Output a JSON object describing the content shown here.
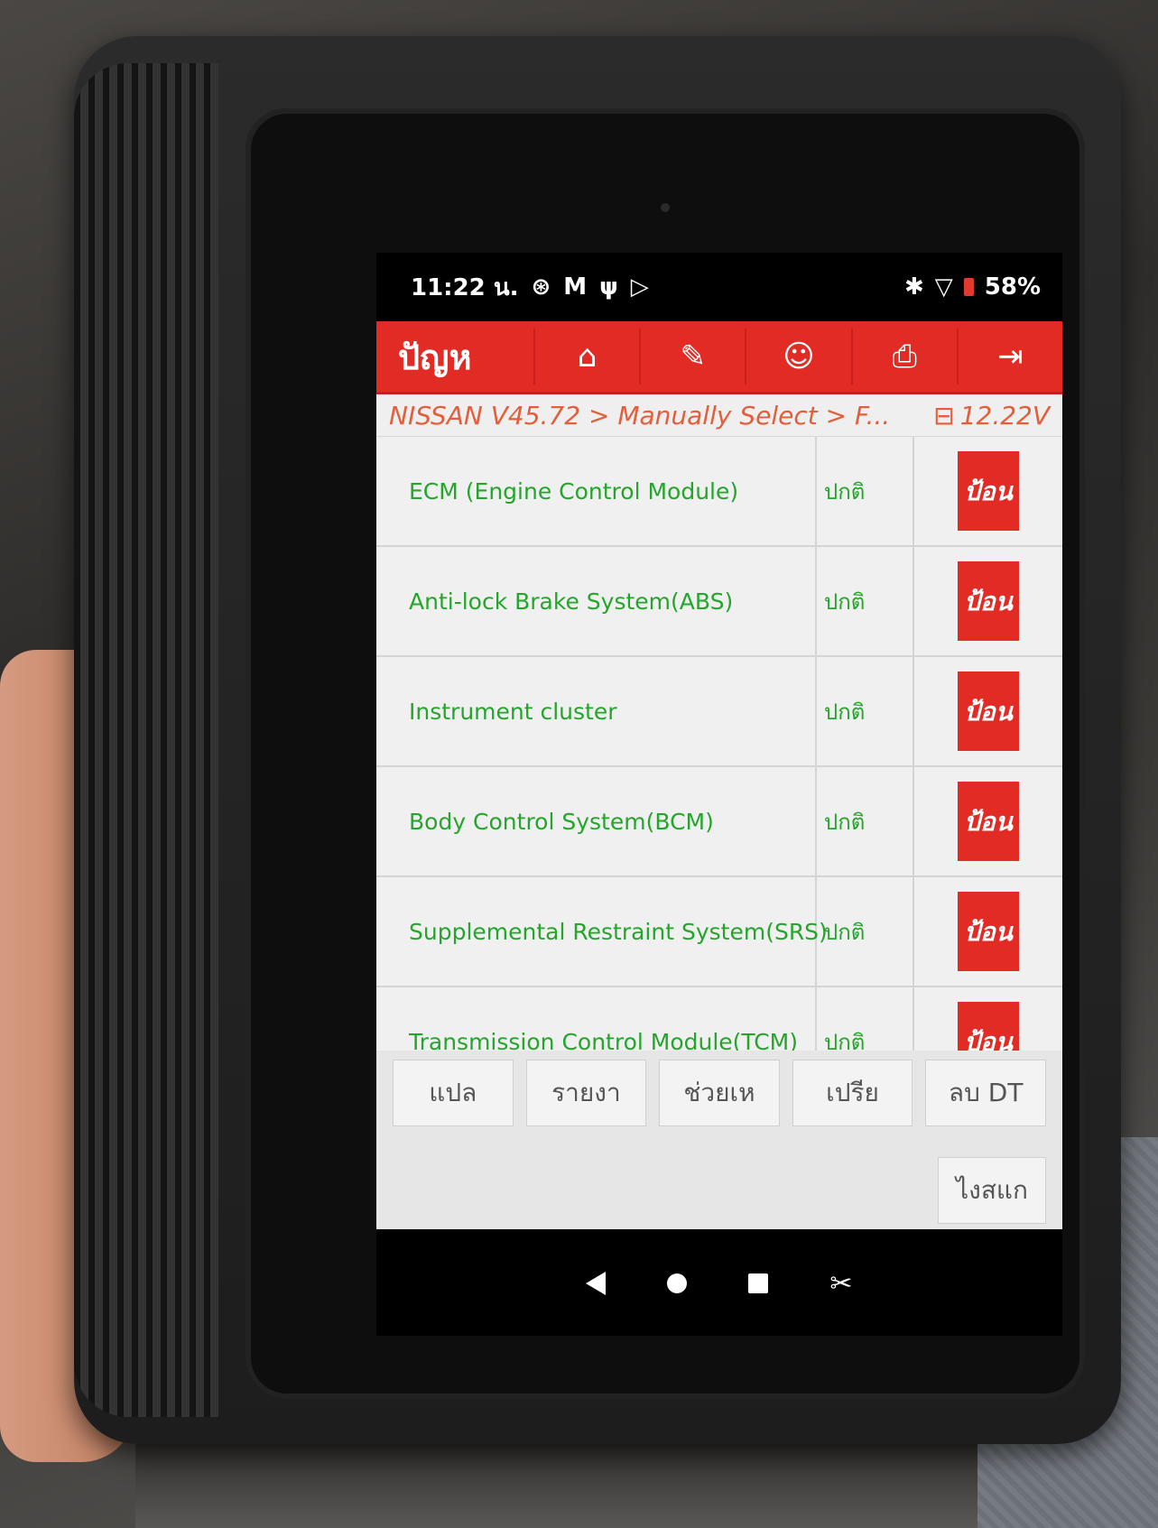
{
  "status_bar": {
    "time": "11:22 น.",
    "icons": [
      "target-icon",
      "gmail-icon",
      "usb-icon",
      "play-store-icon"
    ],
    "battery": "58%"
  },
  "topbar": {
    "title": "ปัญห",
    "buttons": [
      {
        "name": "home",
        "icon": "home-icon",
        "glyph": "⌂"
      },
      {
        "name": "edit",
        "icon": "edit-icon",
        "glyph": "✎"
      },
      {
        "name": "user",
        "icon": "user-icon",
        "glyph": "☺"
      },
      {
        "name": "print",
        "icon": "printer-icon",
        "glyph": "⎙"
      },
      {
        "name": "exit",
        "icon": "exit-icon",
        "glyph": "⇥"
      }
    ]
  },
  "breadcrumb": {
    "path": "NISSAN V45.72 > Manually Select > F...",
    "voltage": "12.22V"
  },
  "modules": [
    {
      "name": "ECM (Engine Control Module)",
      "status": "ปกติ",
      "action": "ป้อน"
    },
    {
      "name": "Anti-lock Brake System(ABS)",
      "status": "ปกติ",
      "action": "ป้อน"
    },
    {
      "name": "Instrument cluster",
      "status": "ปกติ",
      "action": "ป้อน"
    },
    {
      "name": "Body Control System(BCM)",
      "status": "ปกติ",
      "action": "ป้อน"
    },
    {
      "name": "Supplemental Restraint System(SRS)",
      "status": "ปกติ",
      "action": "ป้อน"
    },
    {
      "name": "Transmission Control Module(TCM)",
      "status": "ปกติ",
      "action": "ป้อน"
    }
  ],
  "bottom_buttons": [
    "แปล",
    "รายงา",
    "ช่วยเห",
    "เปรีย",
    "ลบ DT"
  ],
  "bottom_button_2": "ไงสแก",
  "colors": {
    "accent": "#e32b26",
    "text_green": "#24a52b",
    "breadcrumb": "#e35e3a"
  }
}
